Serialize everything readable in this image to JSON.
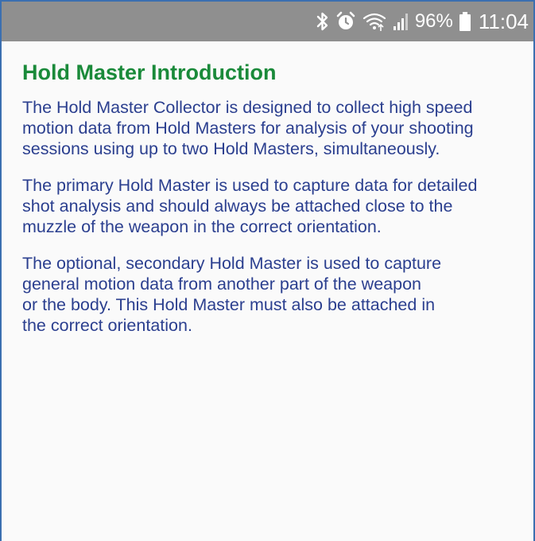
{
  "status_bar": {
    "battery_percent": "96%",
    "time": "11:04",
    "icons": [
      "bluetooth-icon",
      "alarm-icon",
      "wifi-icon",
      "signal-icon",
      "battery-icon"
    ]
  },
  "page": {
    "title": "Hold Master Introduction",
    "paragraphs": [
      "The Hold Master Collector is designed to collect high speed\nmotion data from Hold Masters for analysis of your shooting\nsessions using up to two Hold Masters, simultaneously.",
      "The primary Hold Master is used to capture data for detailed\nshot analysis and should always be attached close to the\nmuzzle of the weapon in the correct orientation.",
      "The optional, secondary Hold Master is used to capture\ngeneral motion data from another part of the weapon\nor the body. This Hold Master must also be attached in\nthe correct orientation."
    ]
  },
  "colors": {
    "title": "#1a8a3a",
    "body_text": "#2b3f8f",
    "status_bar": "#8f8f8f"
  }
}
